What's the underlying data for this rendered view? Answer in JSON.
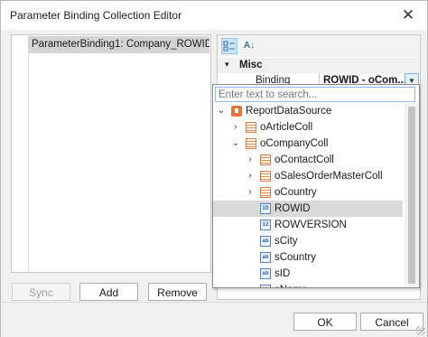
{
  "window": {
    "title": "Parameter Binding Collection Editor",
    "close_glyph": "✕"
  },
  "collection": {
    "items": [
      "ParameterBinding1: Company_ROWID"
    ],
    "buttons": {
      "sync": "Sync",
      "add": "Add",
      "remove": "Remove"
    }
  },
  "property_grid": {
    "category": "Misc",
    "category_toggle": "▾",
    "sort_alpha": "A↓",
    "property": {
      "name": "Binding",
      "value": "ROWID - oCom..."
    },
    "dropdown_glyph": "▼"
  },
  "binding_popup": {
    "search_placeholder": "Enter text to search...",
    "nodes": [
      {
        "label": "ReportDataSource",
        "icon": "data-source-icon",
        "expander": "⌄"
      },
      {
        "label": "oArticleColl",
        "icon": "collection-icon",
        "expander": "›"
      },
      {
        "label": "oCompanyColl",
        "icon": "collection-icon",
        "expander": "⌄"
      },
      {
        "label": "oContactColl",
        "icon": "collection-icon",
        "expander": "›"
      },
      {
        "label": "oSalesOrderMasterColl",
        "icon": "collection-icon",
        "expander": "›"
      },
      {
        "label": "oCountry",
        "icon": "collection-icon",
        "expander": "›"
      },
      {
        "label": "ROWID",
        "icon": "id-field-icon",
        "badge": "ID",
        "selected": true
      },
      {
        "label": "ROWVERSION",
        "icon": "number-field-icon",
        "badge": "12"
      },
      {
        "label": "sCity",
        "icon": "text-field-icon",
        "badge": "ab"
      },
      {
        "label": "sCountry",
        "icon": "text-field-icon",
        "badge": "ab"
      },
      {
        "label": "sID",
        "icon": "text-field-icon",
        "badge": "ab"
      },
      {
        "label": "sName",
        "icon": "text-field-icon",
        "badge": "ab"
      }
    ]
  },
  "footer": {
    "ok": "OK",
    "cancel": "Cancel"
  }
}
